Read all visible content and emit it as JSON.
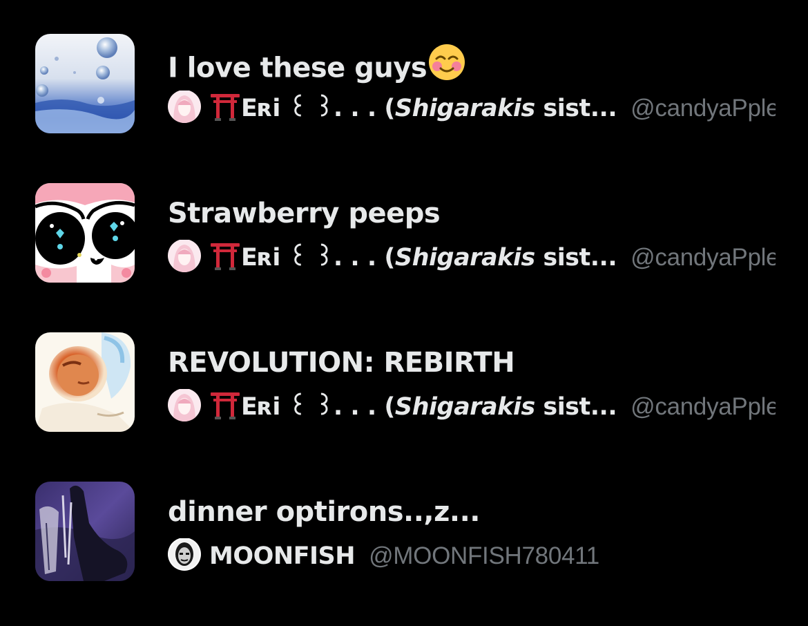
{
  "lists": [
    {
      "title": "I love these guys",
      "title_emoji": "smiling-face-with-smiling-eyes",
      "owner_name_prefix": "Eʀi ꒰ ꒱. . . (",
      "owner_name_italic": "Shigarakis",
      "owner_name_suffix": " sist...",
      "owner_handle": "@candyaPple...",
      "thumbnail": "water-bubbles",
      "owner_avatar": "pink-anime-girl-avatar",
      "owner_badge_icon": "torii-gate-icon"
    },
    {
      "title": "Strawberry peeps",
      "owner_name_prefix": "Eʀi ꒰ ꒱. . . (",
      "owner_name_italic": "Shigarakis",
      "owner_name_suffix": " sist...",
      "owner_handle": "@candyaPple...",
      "thumbnail": "cartoon-eyes-pink",
      "owner_avatar": "pink-anime-girl-avatar",
      "owner_badge_icon": "torii-gate-icon"
    },
    {
      "title": "REVOLUTION: REBIRTH",
      "owner_name_prefix": "Eʀi ꒰ ꒱. . . (",
      "owner_name_italic": "Shigarakis",
      "owner_name_suffix": " sist...",
      "owner_handle": "@candyaPple...",
      "thumbnail": "blurry-face-photo",
      "owner_avatar": "pink-anime-girl-avatar",
      "owner_badge_icon": "torii-gate-icon"
    },
    {
      "title": "dinner optirons..,z...",
      "owner_name": "MOONFISH",
      "owner_handle": "@MOONFISH780411",
      "thumbnail": "dark-purple-anime-figure",
      "owner_avatar": "bw-face-avatar"
    }
  ],
  "colors": {
    "background": "#000000",
    "title_text": "#e7e9ea",
    "handle_text": "#71767b",
    "torii_red": "#d0283a"
  }
}
